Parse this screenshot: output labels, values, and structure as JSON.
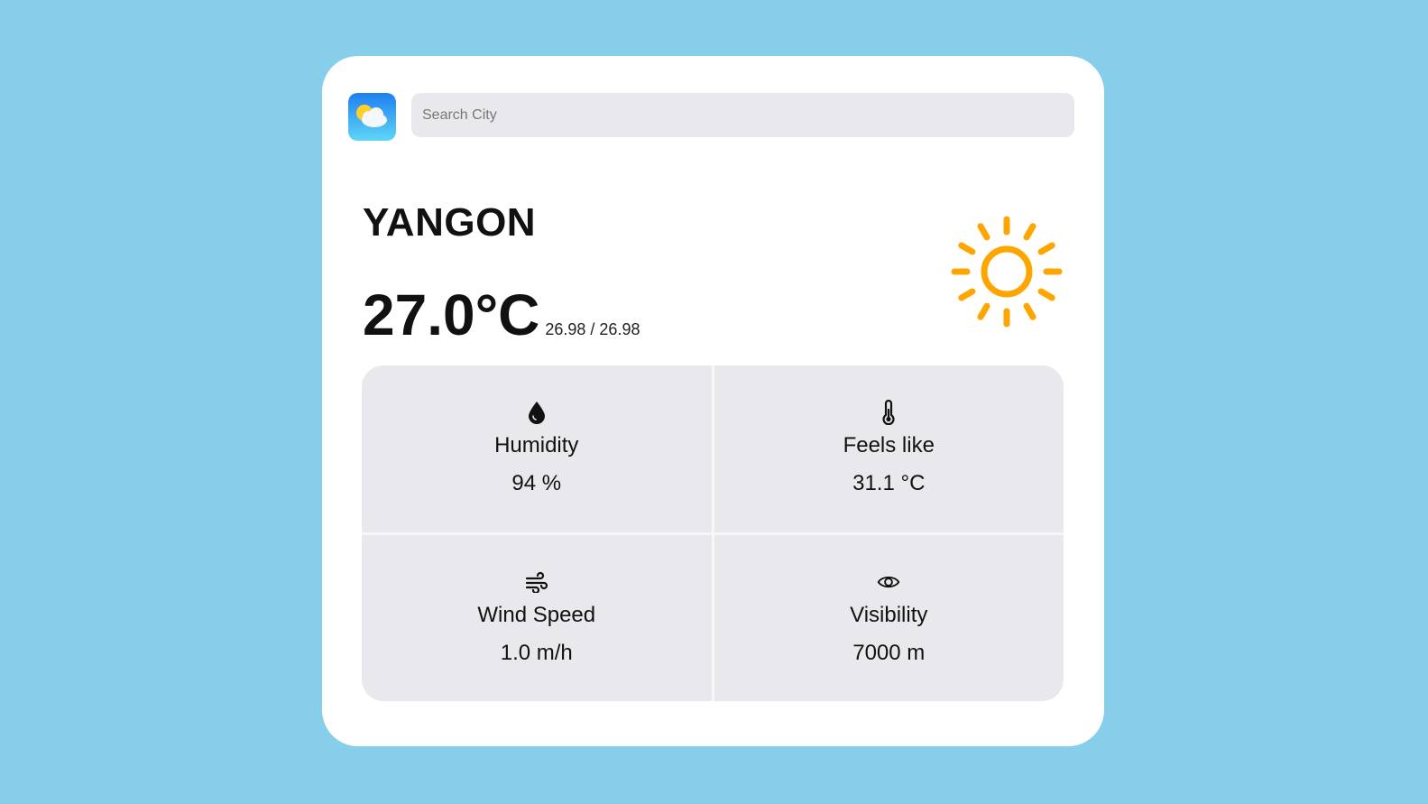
{
  "search": {
    "placeholder": "Search City",
    "value": ""
  },
  "weather": {
    "city": "YANGON",
    "temperature": "27.0°C",
    "min_max": "26.98 / 26.98",
    "condition_icon": "sun-icon"
  },
  "details": [
    {
      "icon": "water-drop-icon",
      "label": "Humidity",
      "value": "94 %"
    },
    {
      "icon": "thermometer-icon",
      "label": "Feels like",
      "value": "31.1 °C"
    },
    {
      "icon": "wind-icon",
      "label": "Wind Speed",
      "value": "1.0 m/h"
    },
    {
      "icon": "eye-icon",
      "label": "Visibility",
      "value": "7000 m"
    }
  ],
  "colors": {
    "background": "#87ceea",
    "card": "#ffffff",
    "panel": "#e9e9ed",
    "sun": "#ffa500",
    "app_icon_top": "#1e90ff",
    "app_icon_bottom": "#5ad1f5"
  }
}
